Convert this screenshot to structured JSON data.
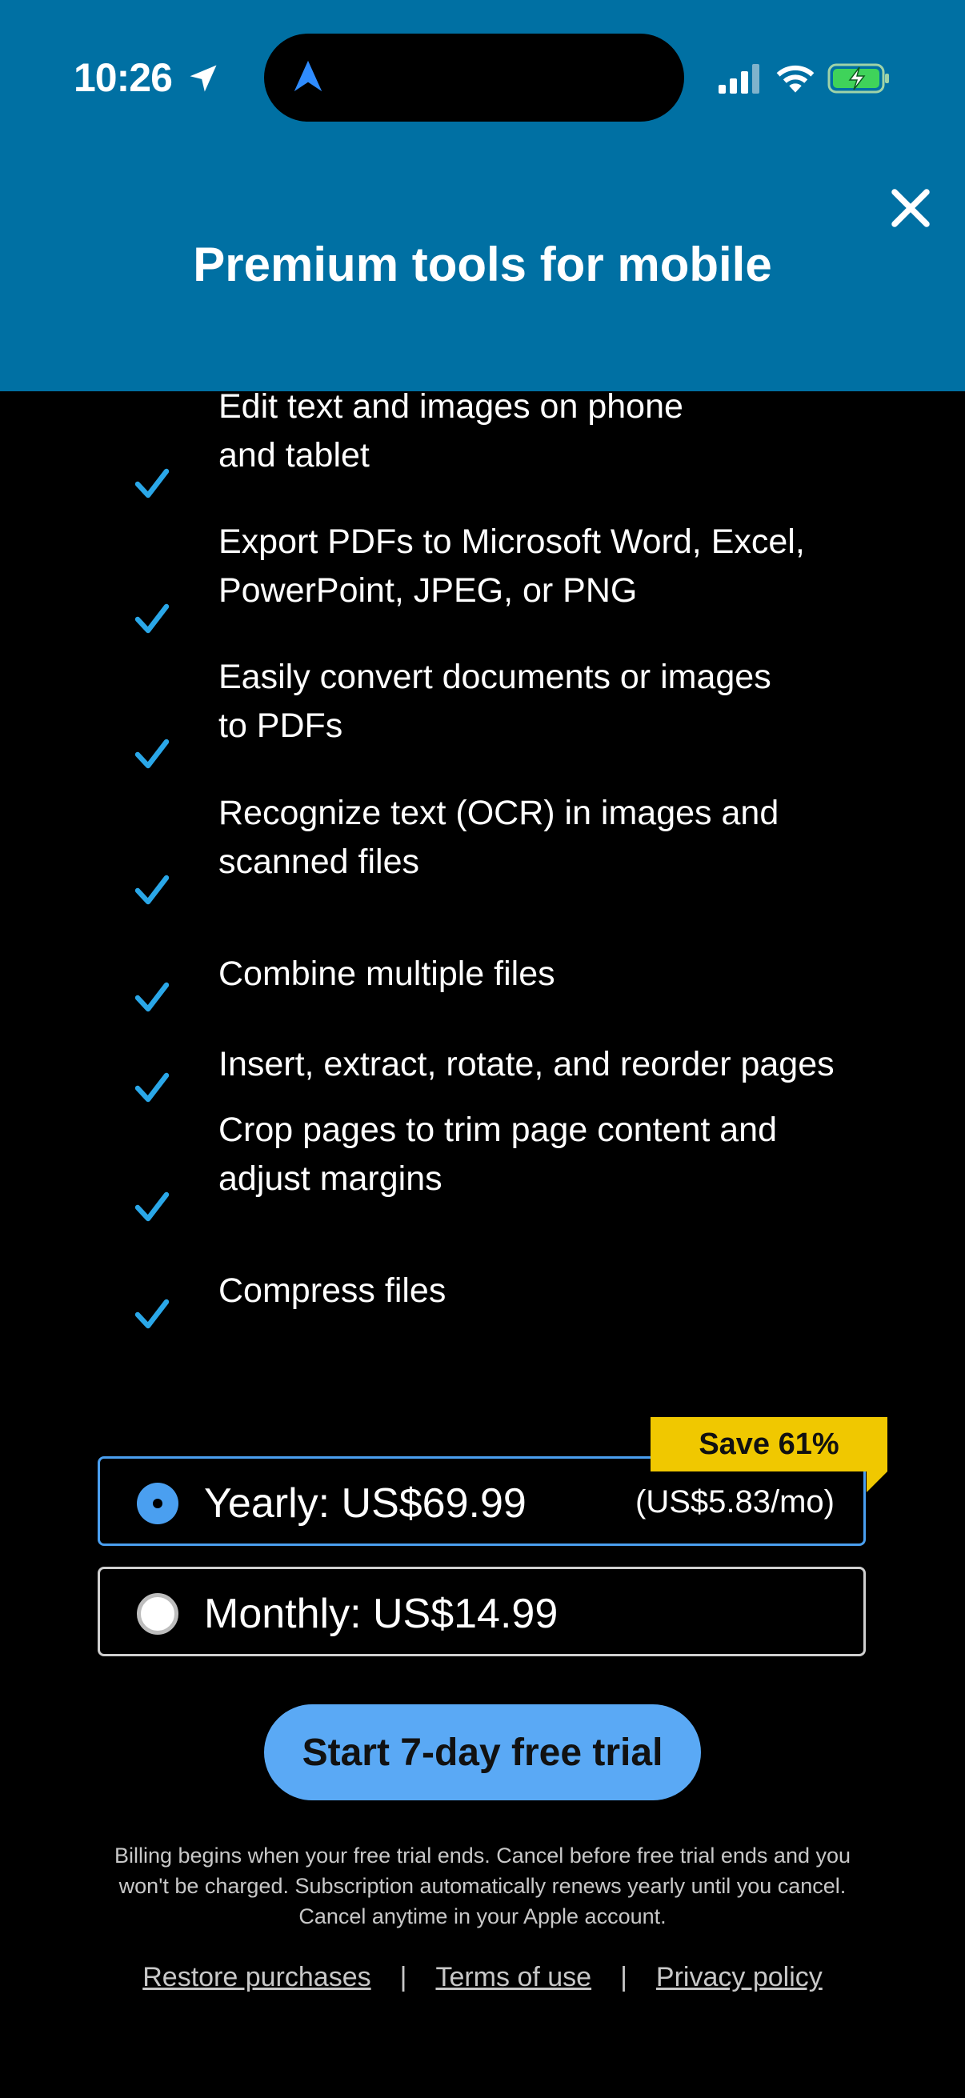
{
  "status_bar": {
    "time": "10:26"
  },
  "header": {
    "title": "Premium tools for mobile"
  },
  "features": [
    {
      "line1": "Edit text and images on phone",
      "line2": "and tablet"
    },
    {
      "line1": "Export PDFs to Microsoft Word, Excel,",
      "line2": "PowerPoint, JPEG, or PNG"
    },
    {
      "line1": "Easily convert documents or images",
      "line2": "to PDFs"
    },
    {
      "line1": "Recognize text (OCR) in images and",
      "line2": "scanned files"
    },
    {
      "line1": "Combine multiple files",
      "line2": ""
    },
    {
      "line1": "Insert, extract, rotate, and reorder pages",
      "line2": ""
    },
    {
      "line1": "Crop pages to trim page content and",
      "line2": "adjust margins"
    },
    {
      "line1": "Compress files",
      "line2": ""
    }
  ],
  "plans": {
    "badge": "Save 61%",
    "yearly": {
      "label": "Yearly: US$69.99",
      "sub": "(US$5.83/mo)",
      "selected": true
    },
    "monthly": {
      "label": "Monthly: US$14.99",
      "selected": false
    }
  },
  "cta": {
    "label": "Start 7-day free trial"
  },
  "fine_print": {
    "line1": "Billing begins when your free trial ends. Cancel before free trial ends and you",
    "line2": "won't be charged. Subscription automatically renews yearly until you cancel.",
    "line3": "Cancel anytime in your Apple account."
  },
  "footer": {
    "restore": "Restore purchases",
    "terms": "Terms of use",
    "privacy": "Privacy policy",
    "separator": "|"
  },
  "colors": {
    "header_bg": "#0070a3",
    "accent_blue": "#4a9ff0",
    "check": "#2aa7e8",
    "badge": "#f0c800"
  },
  "icons": [
    "location-arrow-icon",
    "app-arrow-icon",
    "signal-icon",
    "wifi-icon",
    "battery-charging-icon",
    "close-icon",
    "check-icon"
  ]
}
